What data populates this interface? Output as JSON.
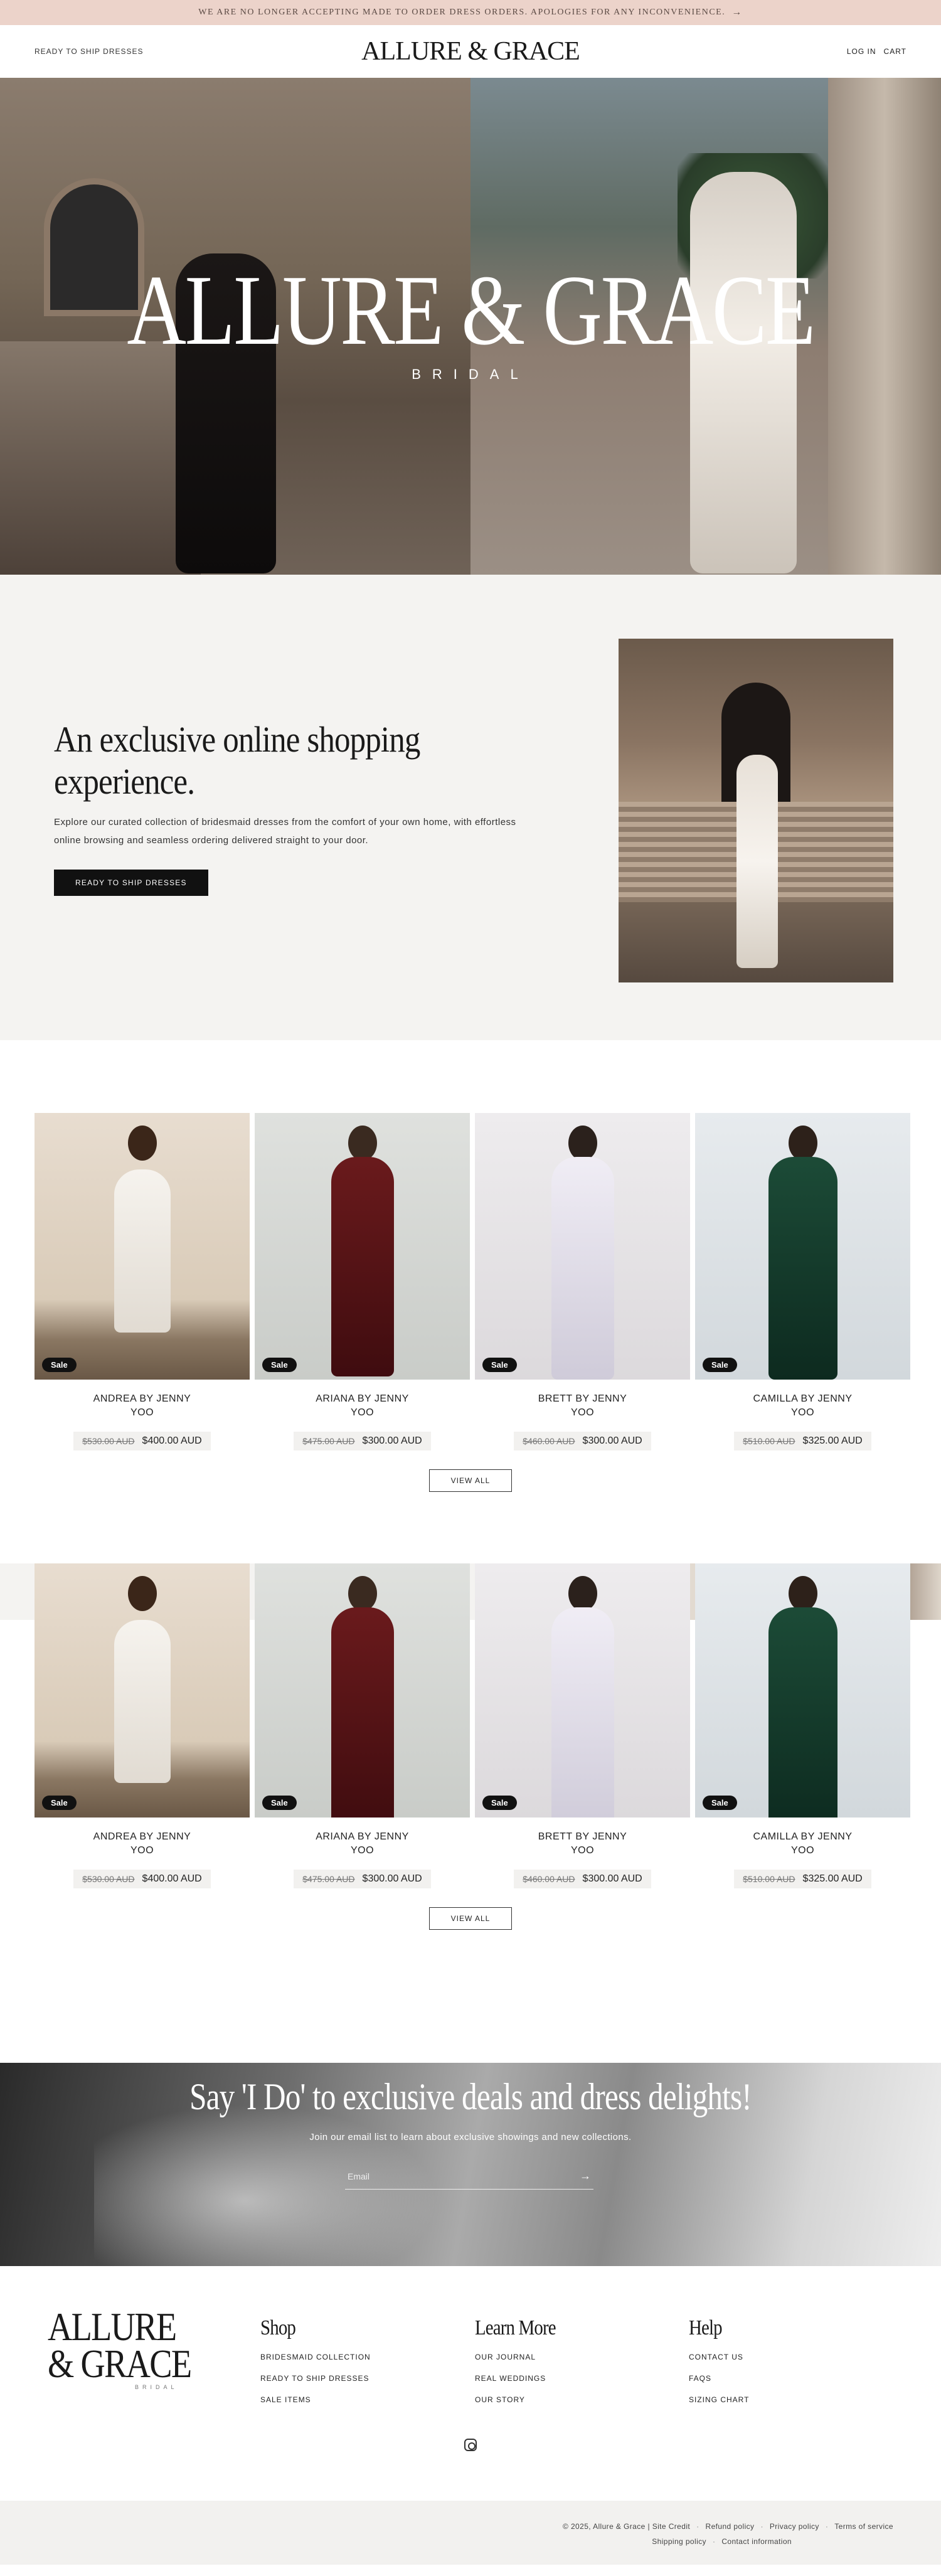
{
  "announcement": {
    "text": "WE ARE NO LONGER ACCEPTING MADE TO ORDER DRESS ORDERS. APOLOGIES FOR ANY INCONVENIENCE.",
    "arrow": "→"
  },
  "header": {
    "left_link": "READY TO SHIP DRESSES",
    "logo": "ALLURE & GRACE",
    "login": "LOG IN",
    "cart": "CART"
  },
  "hero": {
    "title": "ALLURE & GRACE",
    "subtitle": "BRIDAL"
  },
  "intro": {
    "heading_line1": "An exclusive online shopping",
    "heading_line2": "experience.",
    "body": "Explore our curated collection of bridesmaid dresses from the comfort of your own home, with effortless online browsing and seamless ordering delivered straight to your door.",
    "button": "READY TO SHIP DRESSES"
  },
  "products": [
    {
      "name_line1": "ANDREA BY JENNY",
      "name_line2": "YOO",
      "was": "$530.00 AUD",
      "now": "$400.00 AUD",
      "badge": "Sale"
    },
    {
      "name_line1": "ARIANA BY JENNY",
      "name_line2": "YOO",
      "was": "$475.00 AUD",
      "now": "$300.00 AUD",
      "badge": "Sale"
    },
    {
      "name_line1": "BRETT BY JENNY",
      "name_line2": "YOO",
      "was": "$460.00 AUD",
      "now": "$300.00 AUD",
      "badge": "Sale"
    },
    {
      "name_line1": "CAMILLA BY JENNY",
      "name_line2": "YOO",
      "was": "$510.00 AUD",
      "now": "$325.00 AUD",
      "badge": "Sale"
    }
  ],
  "view_all": "VIEW ALL",
  "newsletter": {
    "heading": "Say 'I Do' to exclusive deals and dress delights!",
    "body": "Join our email list to learn about exclusive showings and new collections.",
    "placeholder": "Email",
    "submit": "→"
  },
  "footer": {
    "logo_line1": "ALLURE",
    "logo_line2": "& GRACE",
    "logo_sub": "BRIDAL",
    "shop": {
      "title": "Shop",
      "links": [
        "BRIDESMAID COLLECTION",
        "READY TO SHIP DRESSES",
        "SALE ITEMS"
      ]
    },
    "learn": {
      "title": "Learn More",
      "links": [
        "OUR JOURNAL",
        "REAL WEDDINGS",
        "OUR STORY"
      ]
    },
    "help": {
      "title": "Help",
      "links": [
        "CONTACT US",
        "FAQS",
        "SIZING CHART"
      ]
    },
    "icon": "instagram-icon"
  },
  "subfooter": {
    "copyright": "© 2025, Allure & Grace | Site Credit",
    "refund": "Refund policy",
    "privacy": "Privacy policy",
    "terms": "Terms of service",
    "shipping": "Shipping policy",
    "contact": "Contact information",
    "separator": "·"
  },
  "colors": {
    "announcement_bg": "#ecd3ca",
    "section_bg": "#f4f3f1",
    "button_bg": "#111111"
  }
}
